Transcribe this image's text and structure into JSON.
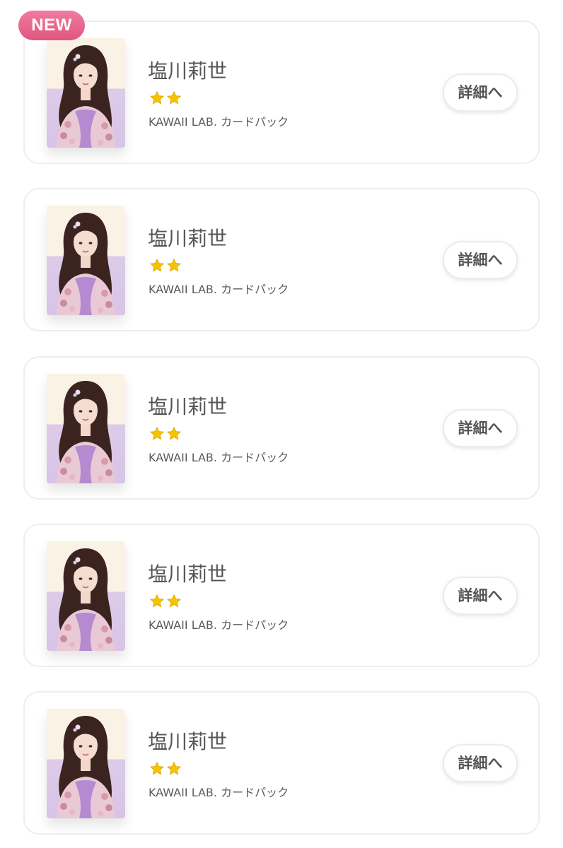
{
  "new_badge": "NEW",
  "items": [
    {
      "name": "塩川莉世",
      "stars": 2,
      "pack": "KAWAII LAB. カードパック",
      "button": "詳細へ"
    },
    {
      "name": "塩川莉世",
      "stars": 2,
      "pack": "KAWAII LAB. カードパック",
      "button": "詳細へ"
    },
    {
      "name": "塩川莉世",
      "stars": 2,
      "pack": "KAWAII LAB. カードパック",
      "button": "詳細へ"
    },
    {
      "name": "塩川莉世",
      "stars": 2,
      "pack": "KAWAII LAB. カードパック",
      "button": "詳細へ"
    },
    {
      "name": "塩川莉世",
      "stars": 2,
      "pack": "KAWAII LAB. カードパック",
      "button": "詳細へ"
    }
  ],
  "colors": {
    "badge": "#e9658e",
    "star": "#f5c400",
    "text": "#555555",
    "card_border": "#eeeeee"
  },
  "icons": {
    "thumbnail": "idol-card-photo",
    "rating": "star-icon"
  }
}
